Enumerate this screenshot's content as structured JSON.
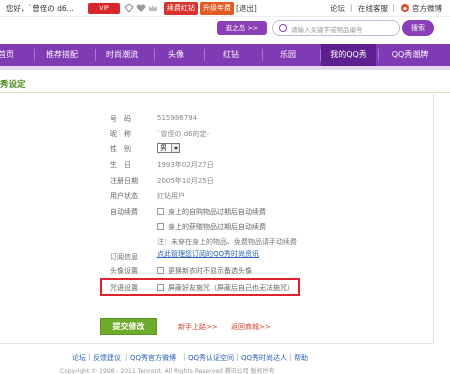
{
  "topbar": {
    "greeting": "您好，`曾侄の d6...",
    "vip_badge": "VIP",
    "renew_red": "续费红钻",
    "upgrade_year": "升级年费",
    "logout": "[退出]",
    "forum": "论坛",
    "online_service": "在线客服",
    "weibo": "官方微博"
  },
  "header": {
    "go_button": "逛之岛 >>",
    "search_placeholder": "请输入关键字或物品编号",
    "search_button": "搜索"
  },
  "nav": {
    "items": [
      "首页",
      "推荐搭配",
      "时尚潮流",
      "头像",
      "红钻",
      "乐园",
      "我的QQ秀",
      "QQ秀潮牌"
    ]
  },
  "page_title": "秀设定",
  "form": {
    "qq_label": "号　码",
    "qq_value": "515986794",
    "nick_label": "昵　称",
    "nick_value": "`曾侄の d6的定-",
    "gender_label": "性　别",
    "gender_value": "男",
    "birthday_label": "生　日",
    "birthday_value": "1993年02月27日",
    "regdate_label": "注册日期",
    "regdate_value": "2005年10月25日",
    "status_label": "用户状态",
    "status_value": "红钻用户",
    "autorenew_label": "自动续费",
    "autorenew_opt1": "身上的自购物品过期后自动续费",
    "autorenew_opt2": "身上的获赠物品过期后自动续费",
    "autorenew_note": "注：未穿在身上的物品、免费物品请手动续费",
    "subscription_label": "订阅信息",
    "subscription_link": "点此管理您订阅的QQ秀时尚资讯",
    "avatar_label": "头像设置",
    "avatar_opt": "更换新衣时不显示备选头像",
    "spell_label": "咒语设置",
    "spell_opt": "屏蔽好友施咒（屏蔽后自己也无法施咒）"
  },
  "actions": {
    "submit": "提交修改",
    "guide": "新手上路>>",
    "back": "返回商城>>"
  },
  "footer": {
    "links": [
      "论坛",
      "反馈建议",
      "QQ秀官方微博",
      "QQ秀认证空间",
      "QQ秀时尚达人",
      "帮助"
    ],
    "second_line": "Copyright © 1998 - 2011 Tencent. All Rights Reserved  腾讯公司 版权所有"
  },
  "colors": {
    "nav_bg": "#7f3ab4",
    "title_green": "#4a8a1d",
    "submit_green": "#6dab2c",
    "highlight_red": "#e0232e"
  }
}
